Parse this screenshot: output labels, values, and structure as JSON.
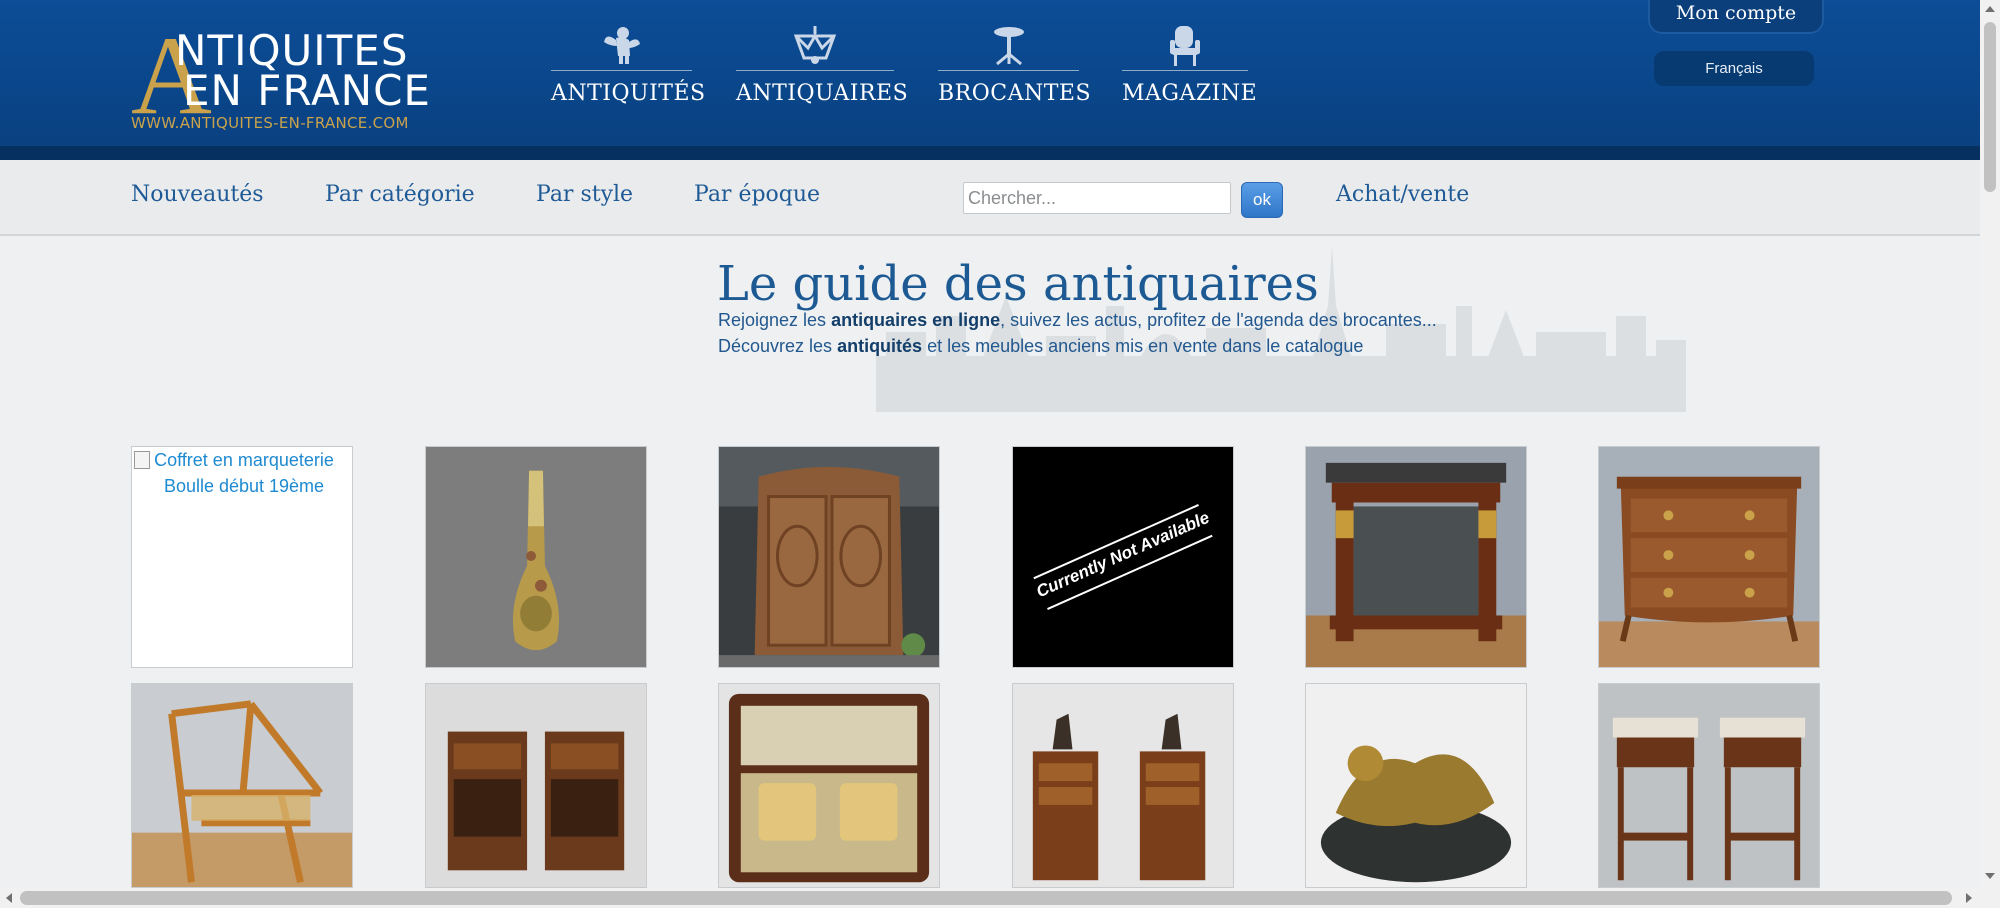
{
  "logo": {
    "letter": "A",
    "line1": "NTIQUITES",
    "line2": "EN FRANCE",
    "url": "WWW.ANTIQUITES-EN-FRANCE.COM"
  },
  "main_nav": [
    {
      "label": "ANTIQUITÉS",
      "icon": "cherub-icon"
    },
    {
      "label": "ANTIQUAIRES",
      "icon": "chandelier-icon"
    },
    {
      "label": "BROCANTES",
      "icon": "gueridon-table-icon"
    },
    {
      "label": "MAGAZINE",
      "icon": "armchair-icon"
    }
  ],
  "account": {
    "label": "Mon compte"
  },
  "language": {
    "label": "Français"
  },
  "subnav": {
    "items": [
      "Nouveautés",
      "Par catégorie",
      "Par style",
      "Par époque"
    ],
    "sell_label": "Achat/vente"
  },
  "search": {
    "placeholder": "Chercher...",
    "button_label": "ok"
  },
  "hero": {
    "title": "Le guide des antiquaires",
    "line1_pre": "Rejoignez les ",
    "line1_bold": "antiquaires en ligne",
    "line1_post": ", suivez les actus, profitez de l'agenda des brocantes...",
    "line2_pre": "Découvrez les ",
    "line2_bold": "antiquités",
    "line2_post": " et les meubles anciens mis en vente dans le catalogue"
  },
  "products": {
    "broken_alt": "Coffret en marqueterie Boulle début 19ème",
    "not_available_text": "Currently Not Available",
    "items": [
      "coffret-boulle",
      "art-nouveau-vase",
      "carved-armoire",
      "not-available",
      "empire-console",
      "louis-xv-commode",
      "bamboo-chair",
      "pair-nightstands",
      "marquetry-inkwell-box",
      "nightstands-with-bronzes",
      "bronze-putti-sculpture",
      "marble-top-side-tables"
    ]
  },
  "colors": {
    "header_blue": "#0c4d97",
    "gold": "#c9a24b",
    "link_blue": "#1e5a96",
    "page_bg": "#eef0f1"
  }
}
